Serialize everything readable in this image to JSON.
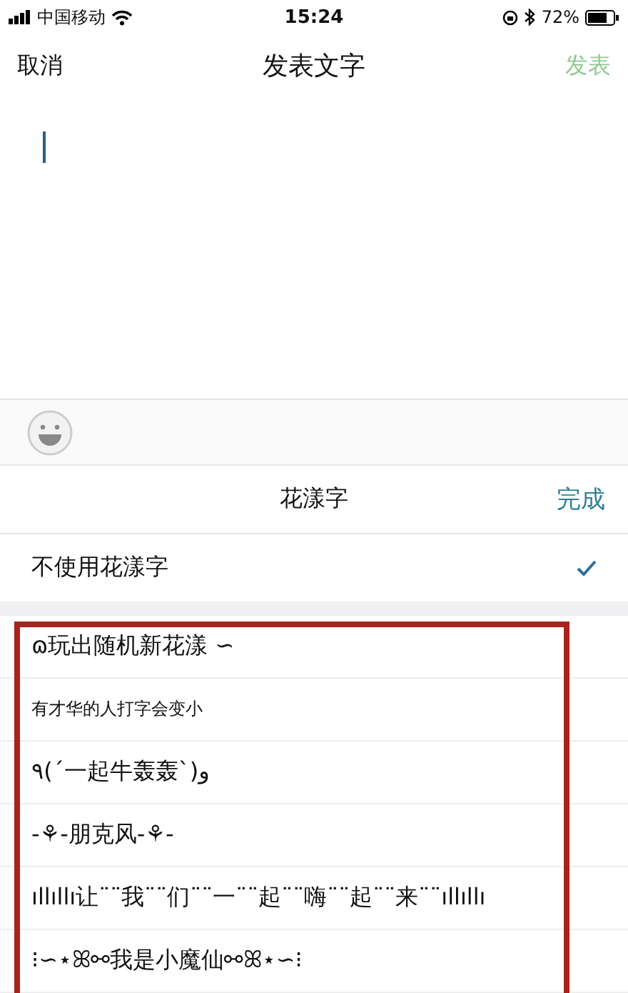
{
  "status_bar": {
    "carrier": "中国移动",
    "time": "15:24",
    "battery": "72%"
  },
  "nav": {
    "cancel": "取消",
    "title": "发表文字",
    "post": "发表",
    "post_disabled": true
  },
  "panel": {
    "title": "花漾字",
    "done": "完成",
    "options": [
      {
        "label": "不使用花漾字",
        "selected": true
      }
    ]
  },
  "styles": [
    {
      "text": "ɷ玩出随机新花漾 ∽",
      "kind": "normal"
    },
    {
      "text": "有才华的人打字会变小",
      "kind": "small"
    },
    {
      "text": "٩(´一起牛轰轰`)و",
      "kind": "normal"
    },
    {
      "text": "-⚘-朋克风-⚘-",
      "kind": "normal"
    },
    {
      "text": "ıllıllı让¨¨我¨¨们¨¨一¨¨起¨¨嗨¨¨起¨¨来¨¨ıllıllı",
      "kind": "normal"
    },
    {
      "text": "⁝∽⋆ꕤ⚯我是小魔仙⚯ꕤ⋆∽⁝",
      "kind": "normal"
    }
  ]
}
